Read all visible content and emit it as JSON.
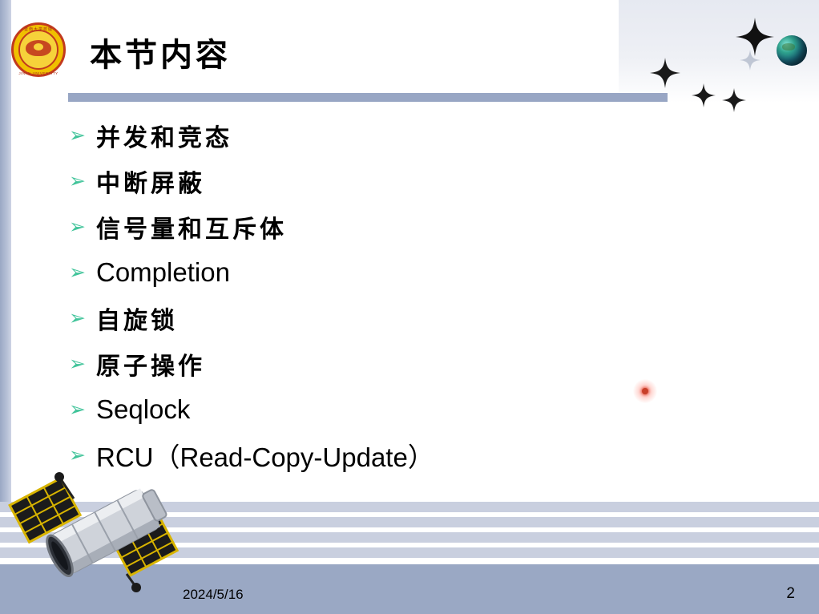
{
  "slide": {
    "title": "本节内容",
    "bullets": [
      {
        "text": "并发和竞态",
        "script": "cjk",
        "marker": "➢"
      },
      {
        "text": "中断屏蔽",
        "script": "cjk",
        "marker": "➢"
      },
      {
        "text": "信号量和互斥体",
        "script": "cjk",
        "marker": "➢"
      },
      {
        "text": "Completion",
        "script": "latin",
        "marker": "➢"
      },
      {
        "text": "自旋锁",
        "script": "cjk",
        "marker": "➢"
      },
      {
        "text": "原子操作",
        "script": "cjk",
        "marker": "➢"
      },
      {
        "text": "Seqlock",
        "script": "latin",
        "marker": "➢"
      },
      {
        "text": "RCU（Read-Copy-Update）",
        "script": "mixed",
        "marker": "➢"
      }
    ],
    "footer": {
      "date": "2024/5/16",
      "page_number": "2"
    },
    "logo": {
      "name": "jinan-university-seal",
      "top_text": "暨南大学校徽",
      "bottom_text": "JINAN UNIVERSITY"
    },
    "decorations": {
      "planet": "planet-icon",
      "satellite": "satellite-icon",
      "red_dot": "red-glow-dot",
      "stars": [
        "star-large",
        "star-medium",
        "star-small-1",
        "star-small-2",
        "star-small-3"
      ]
    },
    "colors": {
      "bullet_marker": "#41c49a",
      "title_bar": "#98a6c4",
      "footer_band": "#9aa8c4",
      "stripe": "#c9cfdf"
    }
  }
}
